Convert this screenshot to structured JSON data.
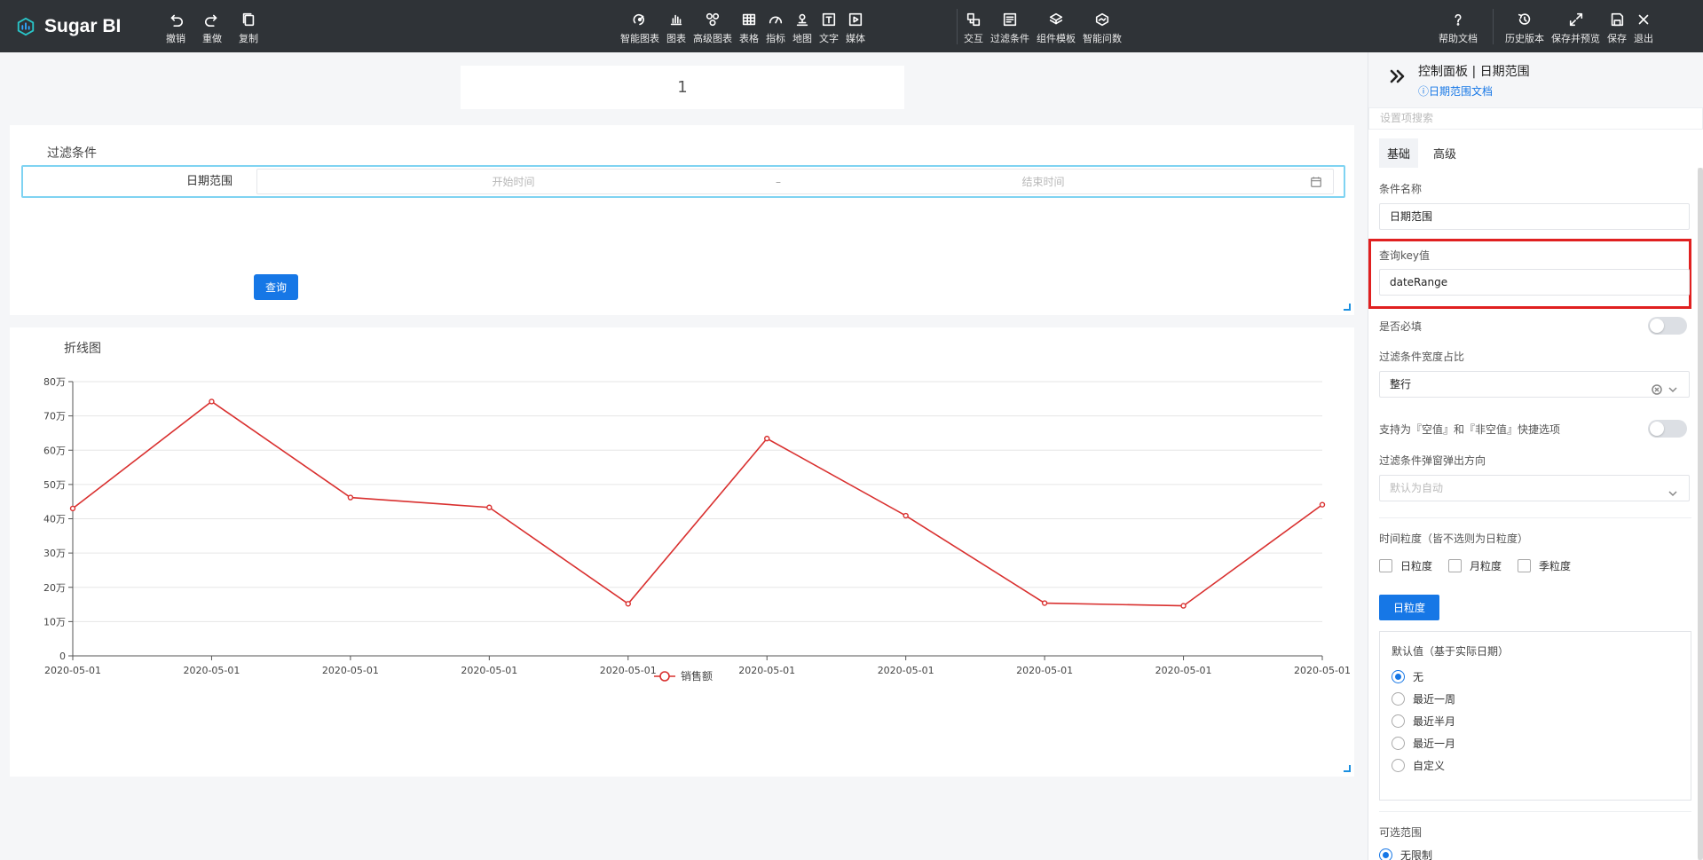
{
  "app": {
    "name": "Sugar BI"
  },
  "toolbar": {
    "left": [
      {
        "id": "undo",
        "label": "撤销",
        "icon": "undo-icon"
      },
      {
        "id": "redo",
        "label": "重做",
        "icon": "redo-icon"
      },
      {
        "id": "copy",
        "label": "复制",
        "icon": "copy-icon"
      }
    ],
    "center": [
      {
        "id": "smart-chart",
        "label": "智能图表",
        "icon": "smart-chart-icon"
      },
      {
        "id": "chart",
        "label": "图表",
        "icon": "bar-chart-icon"
      },
      {
        "id": "advanced-chart",
        "label": "高级图表",
        "icon": "advanced-chart-icon"
      },
      {
        "id": "table",
        "label": "表格",
        "icon": "table-icon"
      },
      {
        "id": "metric",
        "label": "指标",
        "icon": "gauge-icon"
      },
      {
        "id": "map",
        "label": "地图",
        "icon": "map-pin-icon"
      },
      {
        "id": "text",
        "label": "文字",
        "icon": "text-icon"
      },
      {
        "id": "media",
        "label": "媒体",
        "icon": "media-icon"
      }
    ],
    "center2": [
      {
        "id": "interaction",
        "label": "交互",
        "icon": "interaction-icon"
      },
      {
        "id": "filter",
        "label": "过滤条件",
        "icon": "filter-icon"
      },
      {
        "id": "template",
        "label": "组件模板",
        "icon": "template-icon"
      },
      {
        "id": "smart-query",
        "label": "智能问数",
        "icon": "smart-query-icon"
      }
    ],
    "right1": [
      {
        "id": "help",
        "label": "帮助文档",
        "icon": "help-icon"
      }
    ],
    "right2": [
      {
        "id": "history",
        "label": "历史版本",
        "icon": "history-icon"
      },
      {
        "id": "save-preview",
        "label": "保存并预览",
        "icon": "expand-icon"
      },
      {
        "id": "save",
        "label": "保存",
        "icon": "save-icon"
      },
      {
        "id": "exit",
        "label": "退出",
        "icon": "close-icon"
      }
    ]
  },
  "canvas": {
    "title_value": "1",
    "filter": {
      "title": "过滤条件",
      "row_label": "日期范围",
      "start_placeholder": "开始时间",
      "separator": "–",
      "end_placeholder": "结束时间",
      "query_button": "查询"
    },
    "chart_card": {
      "title": "折线图"
    }
  },
  "chart_data": {
    "type": "line",
    "title": "折线图",
    "categories": [
      "2020-05-01",
      "2020-05-01",
      "2020-05-01",
      "2020-05-01",
      "2020-05-01",
      "2020-05-01",
      "2020-05-01",
      "2020-05-01",
      "2020-05-01",
      "2020-05-01"
    ],
    "series": [
      {
        "name": "销售额",
        "values": [
          430000,
          742000,
          462000,
          433000,
          152000,
          634000,
          409000,
          154000,
          146000,
          441000
        ],
        "color": "#d9302f"
      }
    ],
    "y_ticks": [
      "0",
      "10万",
      "20万",
      "30万",
      "40万",
      "50万",
      "60万",
      "70万",
      "80万"
    ],
    "ylim": [
      0,
      800000
    ],
    "grid": true,
    "legend": "bottom-center"
  },
  "panel": {
    "header_title": "控制面板 | 日期范围",
    "doc_link": "日期范围文档",
    "search_placeholder": "设置项搜索",
    "tabs": [
      {
        "label": "基础",
        "active": true
      },
      {
        "label": "高级",
        "active": false
      }
    ],
    "condition_name_label": "条件名称",
    "condition_name_value": "日期范围",
    "query_key_label": "查询key值",
    "query_key_value": "dateRange",
    "required_label": "是否必填",
    "width_ratio_label": "过滤条件宽度占比",
    "width_ratio_value": "整行",
    "empty_option_label": "支持为『空值』和『非空值』快捷选项",
    "popup_direction_label": "过滤条件弹窗弹出方向",
    "popup_direction_placeholder": "默认为自动",
    "granularity_label": "时间粒度（皆不选则为日粒度）",
    "granularity_options": [
      "日粒度",
      "月粒度",
      "季粒度"
    ],
    "granularity_button": "日粒度",
    "default_title": "默认值（基于实际日期）",
    "default_options": [
      {
        "label": "无",
        "checked": true
      },
      {
        "label": "最近一周",
        "checked": false
      },
      {
        "label": "最近半月",
        "checked": false
      },
      {
        "label": "最近一月",
        "checked": false
      },
      {
        "label": "自定义",
        "checked": false
      }
    ],
    "selectable_range_label": "可选范围",
    "selectable_range_first": "无限制"
  }
}
